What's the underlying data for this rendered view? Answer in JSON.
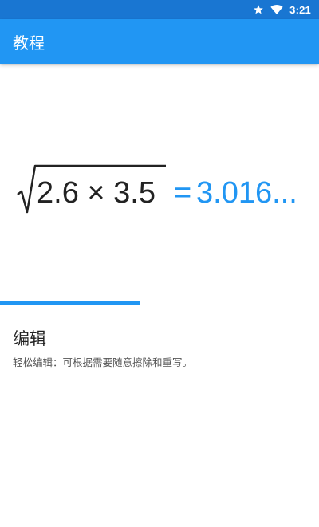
{
  "status_bar": {
    "time": "3:21",
    "icons": [
      "star-icon",
      "wifi-icon"
    ],
    "background": "#1976d2"
  },
  "app_bar": {
    "title": "教程",
    "background": "#2196f3"
  },
  "formula": {
    "radicand": "2.6 × 3.5",
    "equals": "=",
    "result": "3.016...",
    "result_color": "#2196f3",
    "expression_color": "#222222"
  },
  "progress": {
    "fraction": 0.44,
    "color": "#2196f3"
  },
  "section": {
    "title": "编辑",
    "description": "轻松编辑：可根据需要随意擦除和重写。"
  }
}
